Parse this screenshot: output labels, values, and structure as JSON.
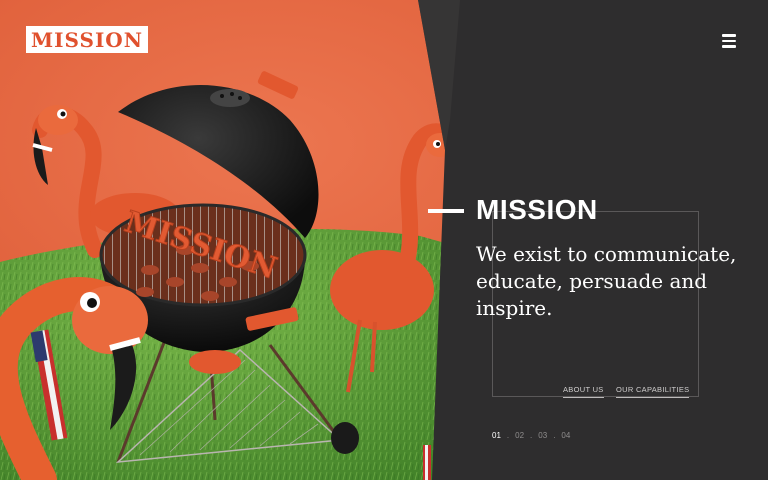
{
  "brand": {
    "logo_text": "MISSION"
  },
  "menu": {
    "icon": "hamburger-menu-icon"
  },
  "hero": {
    "grill_lettering": "MISSION",
    "illustration": "flamingos-around-bbq-grill"
  },
  "section": {
    "heading": "MISSION",
    "body": "We exist to communicate, educate, persuade and inspire."
  },
  "links": [
    {
      "label": "ABOUT US"
    },
    {
      "label": "OUR CAPABILITIES"
    }
  ],
  "pager": {
    "pages": [
      "01",
      "02",
      "03",
      "04"
    ],
    "separator": ".",
    "active_index": 0
  },
  "colors": {
    "accent_orange": "#e0512e",
    "background_orange": "#e56a44",
    "panel_dark": "#2e2d2e",
    "grass_green": "#5a9e35",
    "text_white": "#ffffff"
  }
}
